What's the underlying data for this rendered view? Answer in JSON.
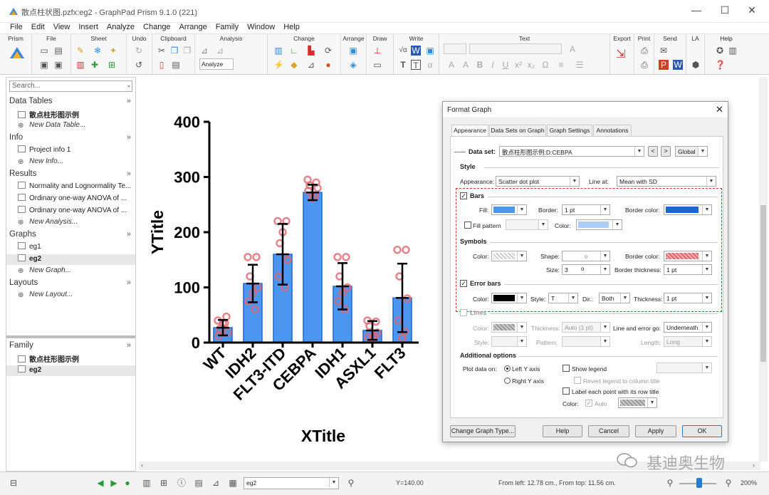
{
  "window": {
    "title": "散点柱状图.pzfx:eg2 - GraphPad Prism 9.1.0 (221)",
    "min": "—",
    "max": "☐",
    "close": "✕"
  },
  "menu": [
    "File",
    "Edit",
    "View",
    "Insert",
    "Analyze",
    "Change",
    "Arrange",
    "Family",
    "Window",
    "Help"
  ],
  "ribbon": {
    "groups": [
      "Prism",
      "File",
      "Sheet",
      "Undo",
      "Clipboard",
      "Analysis",
      "Change",
      "Arrange",
      "Draw",
      "Write",
      "Text",
      "Export",
      "Print",
      "Send",
      "LA",
      "Help"
    ],
    "analyze_label": "Analyze"
  },
  "navigator": {
    "search_placeholder": "Search...",
    "data_tables": {
      "title": "Data Tables",
      "items": [
        "散点柱形图示例"
      ],
      "new": "New Data Table..."
    },
    "info": {
      "title": "Info",
      "items": [
        "Project info 1"
      ],
      "new": "New Info..."
    },
    "results": {
      "title": "Results",
      "items": [
        "Normality and Lognormality Te...",
        "Ordinary one-way ANOVA of ...",
        "Ordinary one-way ANOVA of ..."
      ],
      "new": "New Analysis..."
    },
    "graphs": {
      "title": "Graphs",
      "items": [
        "eg1",
        "eg2"
      ],
      "new": "New Graph..."
    },
    "layouts": {
      "title": "Layouts",
      "new": "New Layout..."
    },
    "family": {
      "title": "Family",
      "items": [
        "散点柱形图示例",
        "eg2"
      ]
    }
  },
  "chart_data": {
    "type": "bar",
    "categories": [
      "WT",
      "IDH2",
      "FLT3-ITD",
      "CEBPA",
      "IDH1",
      "ASXL1",
      "FLT3"
    ],
    "values": [
      27,
      107,
      160,
      272,
      102,
      22,
      81
    ],
    "sd": [
      14,
      34,
      55,
      14,
      42,
      17,
      62
    ],
    "points": [
      [
        40,
        47,
        25,
        18,
        12,
        35,
        35
      ],
      [
        155,
        155,
        120,
        100,
        75,
        60,
        90
      ],
      [
        220,
        220,
        180,
        150,
        120,
        100,
        200
      ],
      [
        295,
        290,
        285,
        280,
        275,
        265,
        262
      ],
      [
        155,
        155,
        120,
        100,
        75,
        60,
        90
      ],
      [
        40,
        38,
        30,
        18,
        10,
        12,
        8
      ],
      [
        168,
        168,
        120,
        80,
        40,
        20,
        8
      ]
    ],
    "xlabel": "XTitle",
    "ylabel": "YTitle",
    "ylim": [
      0,
      400
    ],
    "yticks": [
      0,
      100,
      200,
      300,
      400
    ],
    "bar_color": "#4d96f0",
    "bar_border": "#1a66d6",
    "point_color": "#e06670",
    "errbar_color": "#000000"
  },
  "dialog": {
    "title": "Format Graph",
    "tabs": [
      "Appearance",
      "Data Sets on Graph",
      "Graph Settings",
      "Annotations"
    ],
    "data_set_label": "Data set:",
    "data_set_value": "散点柱形图示例:D:CEBPA",
    "prev": "<",
    "next": ">",
    "global": "Global",
    "style_header": "Style",
    "appearance_label": "Appearance:",
    "appearance_value": "Scatter dot plot",
    "line_at_label": "Line at:",
    "line_at_value": "Mean with SD",
    "bars_header": "Bars",
    "fill_label": "Fill:",
    "border_label": "Border:",
    "border_value": "1 pt",
    "border_color_label": "Border color:",
    "fill_pattern_label": "Fill pattern",
    "color_label": "Color:",
    "symbols_header": "Symbols",
    "shape_label": "Shape:",
    "shape_value": "○",
    "size_label": "Size:",
    "size_value": "3",
    "border_thickness_label": "Border thickness:",
    "border_thickness_value": "1 pt",
    "error_bars_header": "Error bars",
    "eb_style_label": "Style:",
    "eb_style_value": "T",
    "dir_label": "Dir.:",
    "dir_value": "Both",
    "thickness_label": "Thickness:",
    "thickness_value": "1 pt",
    "lines_header": "Lines",
    "lines_thickness_value": "Auto (1 pt)",
    "line_error_label": "Line and error go:",
    "line_error_value": "Underneath",
    "pattern_label": "Pattern:",
    "length_label": "Length:",
    "length_value": "Long",
    "additional_header": "Additional options",
    "plot_on_label": "Plot data on:",
    "left_axis": "Left Y axis",
    "right_axis": "Right  Y axis",
    "show_legend": "Show legend",
    "revert_legend": "Revert legend to column title",
    "label_each": "Label each point with its row title",
    "auto": "Auto",
    "buttons": {
      "change_type": "Change Graph Type...",
      "help": "Help",
      "cancel": "Cancel",
      "apply": "Apply",
      "ok": "OK"
    }
  },
  "status": {
    "sheet": "eg2",
    "y_readout": "Y=140.00",
    "position": "From left: 12.78 cm., From top: 11.56 cm.",
    "zoom": "200%"
  },
  "watermark": "基迪奥生物"
}
